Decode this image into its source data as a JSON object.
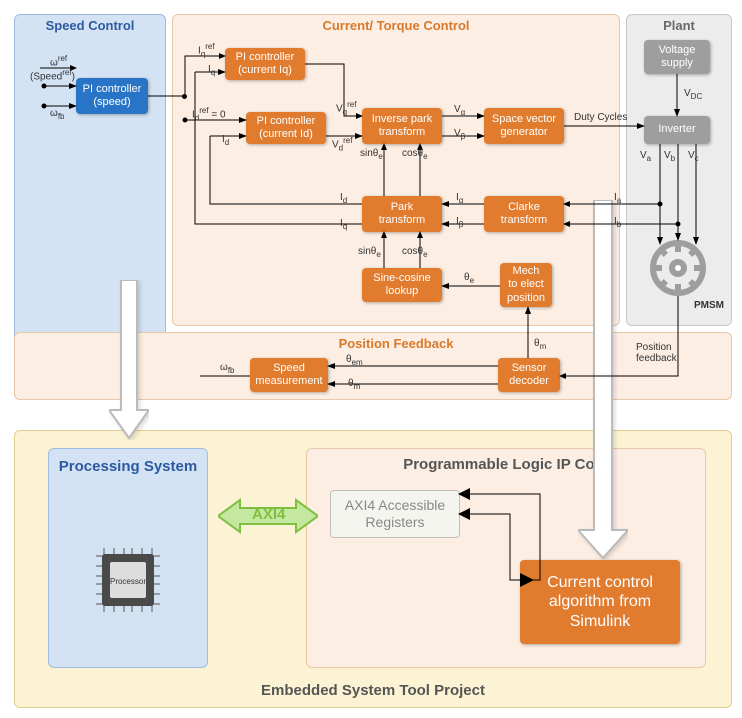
{
  "panels": {
    "speed": "Speed Control",
    "current": "Current/ Torque Control",
    "plant": "Plant",
    "position": "Position Feedback",
    "processing": "Processing System",
    "plcore": "Programmable Logic IP Core",
    "embedded": "Embedded System Tool Project"
  },
  "blocks": {
    "pi_speed": "PI controller\n(speed)",
    "pi_iq": "PI controller\n(current Iq)",
    "pi_id": "PI controller\n(current Id)",
    "inv_park": "Inverse park\ntransform",
    "svg": "Space vector\ngenerator",
    "park": "Park\ntransform",
    "clarke": "Clarke\ntransform",
    "sincos": "Sine-cosine\nlookup",
    "mech": "Mech\nto elect\nposition",
    "speedm": "Speed\nmeasurement",
    "sensor": "Sensor\ndecoder",
    "voltage": "Voltage\nsupply",
    "inverter": "Inverter",
    "axi4reg": "AXI4 Accessible\nRegisters",
    "ccas": "Current control\nalgorithm from\nSimulink",
    "processor": "Processor"
  },
  "labels": {
    "wref": "ω<sup>ref</sup>",
    "speedref": "(Speed<sup>ref</sup>)",
    "wfb": "ω",
    "iqref": "I",
    "iq": "I",
    "idref": "I",
    "id": "I",
    "vqref": "V",
    "vdref": "V",
    "valpha": "V",
    "vbeta": "V",
    "duty": "Duty Cycles",
    "vdc": "V",
    "va": "V",
    "vb": "V",
    "vc": "V",
    "ia": "I",
    "ib": "I",
    "ialpha": "I",
    "ibeta": "I",
    "sinth": "sinθ",
    "costh": "cosθ",
    "the": "θ",
    "thm": "θ",
    "them": "θ",
    "posfb": "Position\nfeedback",
    "pmsm": "PMSM",
    "axi4": "AXI4"
  }
}
